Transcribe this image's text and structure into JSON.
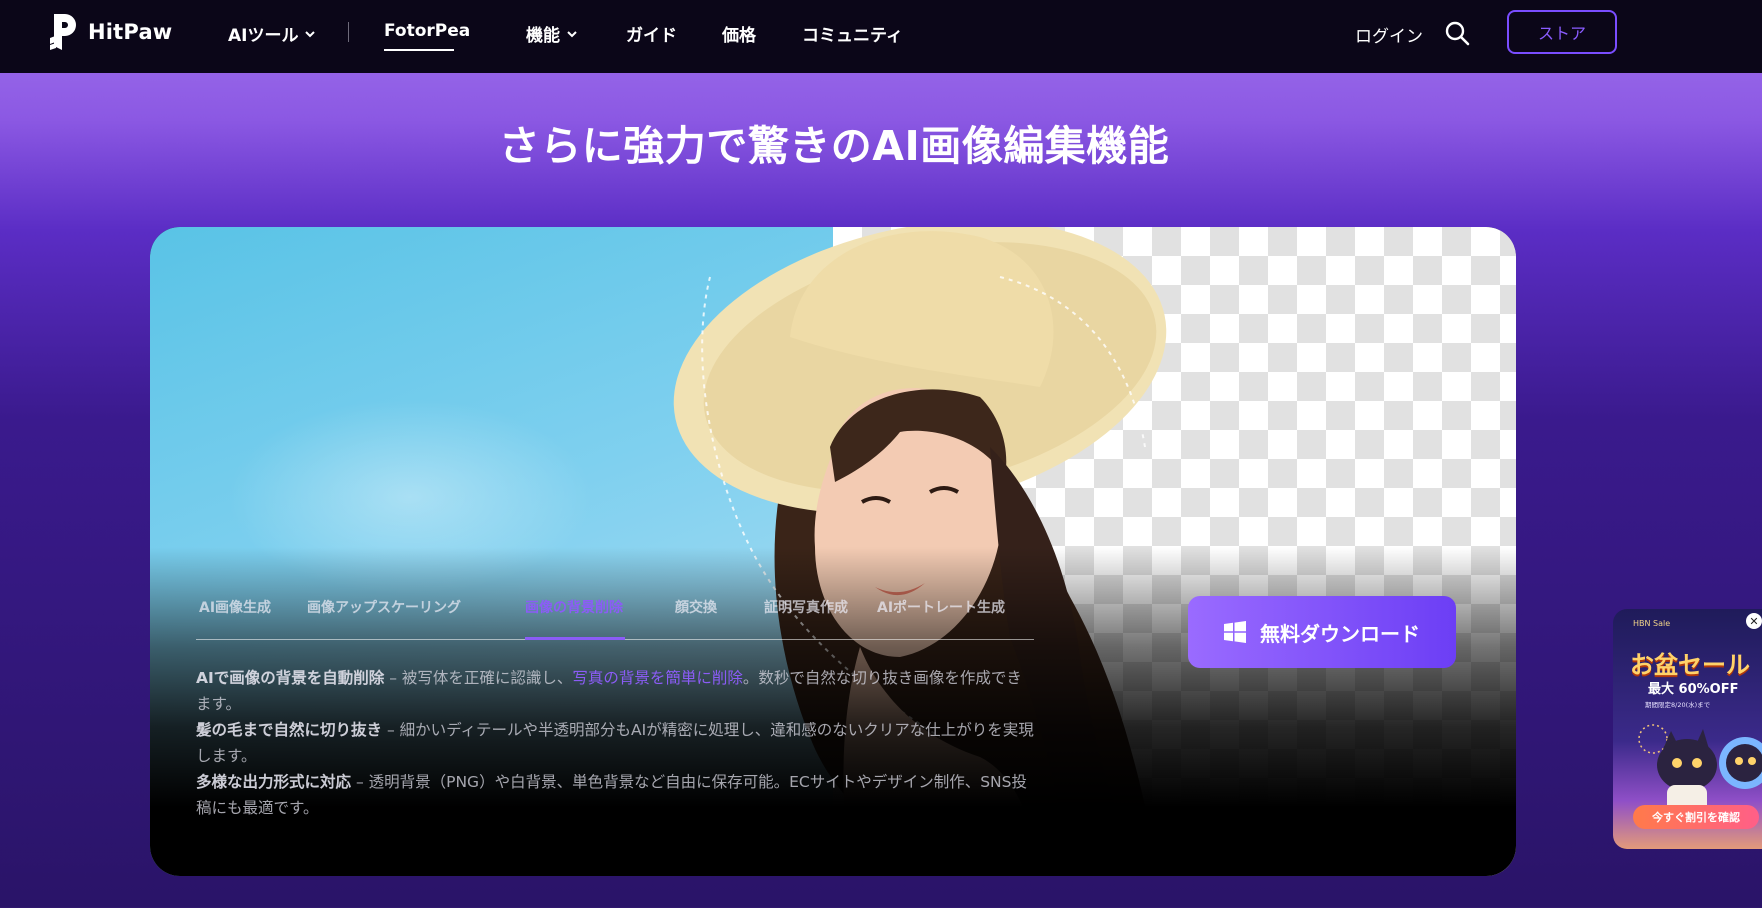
{
  "nav": {
    "logo_text": "HitPaw",
    "ai_tools": "AIツール",
    "fotorpea": "FotorPea",
    "features": "機能",
    "guide": "ガイド",
    "price": "価格",
    "community": "コミュニティ",
    "login": "ログイン",
    "store": "ストア"
  },
  "heading": "さらに強力で驚きのAI画像編集機能",
  "tabs": [
    {
      "label": "AI画像生成"
    },
    {
      "label": "画像アップスケーリング"
    },
    {
      "label": "画像の背景削除"
    },
    {
      "label": "顔交換"
    },
    {
      "label": "証明写真作成"
    },
    {
      "label": "AIポートレート生成"
    }
  ],
  "active_tab": "画像の背景削除",
  "description": {
    "p1_bold": "AIで画像の背景を自動削除",
    "p1_a": " – 被写体を正確に認識し、",
    "p1_link": "写真の背景を簡単に削除",
    "p1_b": "。数秒で自然な切り抜き画像を作成できます。",
    "p2_bold": "髪の毛まで自然に切り抜き",
    "p2_text": " – 細かいディテールや半透明部分もAIが精密に処理し、違和感のないクリアな仕上がりを実現します。",
    "p3_bold": "多様な出力形式に対応",
    "p3_text": " – 透明背景（PNG）や白背景、単色背景など自由に保存可能。ECサイトやデザイン制作、SNS投稿にも最適です。"
  },
  "download_button": "無料ダウンロード",
  "promo": {
    "sale_label": "HBN Sale",
    "title": "お盆セール",
    "discount": "最大 60%OFF",
    "period": "期間限定8/20(水)まで",
    "cta": "今すぐ割引を確認"
  },
  "colors": {
    "accent": "#8b5cf6",
    "nav_bg": "#0b0618",
    "store_border": "#7a4dff"
  }
}
